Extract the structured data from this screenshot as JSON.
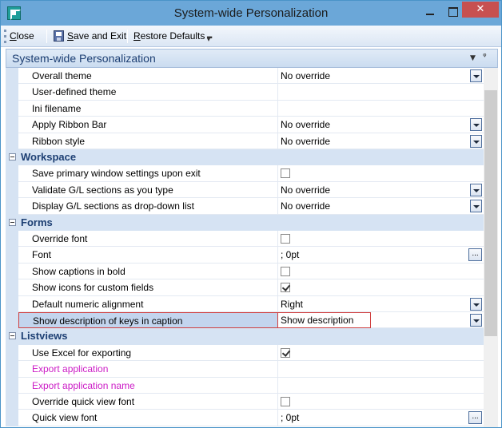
{
  "window": {
    "title": "System-wide Personalization",
    "close_glyph": "✕",
    "icons": [
      "app-icon",
      "minimize-icon",
      "maximize-icon",
      "close-icon"
    ]
  },
  "toolbar": {
    "close_label_u": "C",
    "close_label_rest": "lose",
    "save_label_u": "S",
    "save_label_rest": "ave and Exit",
    "restore_label_u": "R",
    "restore_label_rest": "estore Defaults",
    "icons": [
      "save-icon",
      "overflow-chevron-icon"
    ]
  },
  "panel": {
    "title": "System-wide Personalization",
    "dropdown_glyph": "▼",
    "pin_glyph": "📌"
  },
  "grid": {
    "rows": [
      {
        "kind": "prop",
        "name": "Overall theme",
        "value": "No override",
        "editor": "dropdown"
      },
      {
        "kind": "prop",
        "name": "User-defined theme",
        "value": "",
        "editor": "none"
      },
      {
        "kind": "prop",
        "name": "Ini filename",
        "value": "",
        "editor": "none"
      },
      {
        "kind": "prop",
        "name": "Apply Ribbon Bar",
        "value": "No override",
        "editor": "dropdown"
      },
      {
        "kind": "prop",
        "name": "Ribbon style",
        "value": "No override",
        "editor": "dropdown"
      },
      {
        "kind": "category",
        "name": "Workspace"
      },
      {
        "kind": "prop",
        "name": "Save primary window settings upon exit",
        "value": "",
        "editor": "checkbox",
        "checked": false
      },
      {
        "kind": "prop",
        "name": "Validate G/L sections as you type",
        "value": "No override",
        "editor": "dropdown"
      },
      {
        "kind": "prop",
        "name": "Display G/L sections as drop-down list",
        "value": "No override",
        "editor": "dropdown"
      },
      {
        "kind": "category",
        "name": "Forms"
      },
      {
        "kind": "prop",
        "name": "Override font",
        "value": "",
        "editor": "checkbox",
        "checked": false
      },
      {
        "kind": "prop",
        "name": "Font",
        "value": "; 0pt",
        "editor": "ellipsis"
      },
      {
        "kind": "prop",
        "name": "Show captions in bold",
        "value": "",
        "editor": "checkbox",
        "checked": false
      },
      {
        "kind": "prop",
        "name": "Show icons for custom fields",
        "value": "",
        "editor": "checkbox",
        "checked": true
      },
      {
        "kind": "prop",
        "name": "Default numeric alignment",
        "value": "Right",
        "editor": "dropdown"
      },
      {
        "kind": "prop",
        "name": "Show description of keys in caption",
        "value": "Show description",
        "editor": "dropdown",
        "selected": true
      },
      {
        "kind": "category",
        "name": "Listviews"
      },
      {
        "kind": "prop",
        "name": "Use Excel for exporting",
        "value": "",
        "editor": "checkbox",
        "checked": true
      },
      {
        "kind": "prop",
        "name": "Export application",
        "value": "",
        "editor": "none",
        "color": "pink"
      },
      {
        "kind": "prop",
        "name": "Export application name",
        "value": "",
        "editor": "none",
        "color": "pink"
      },
      {
        "kind": "prop",
        "name": "Override quick view font",
        "value": "",
        "editor": "checkbox",
        "checked": false
      },
      {
        "kind": "prop",
        "name": "Quick view font",
        "value": "; 0pt",
        "editor": "ellipsis"
      }
    ]
  },
  "colors": {
    "category_text": "#1d3f73",
    "pink_text": "#cc1cc6",
    "selection": "#c3d5ee",
    "highlight_border": "#d04040"
  }
}
